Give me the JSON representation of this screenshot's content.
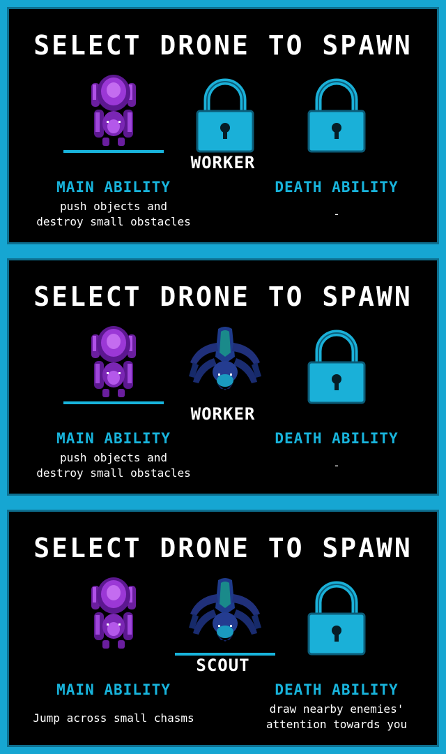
{
  "colors": {
    "background": "#16a6d2",
    "panel": "#000000",
    "accent": "#18b4dc",
    "text": "#ffffff",
    "worker_drone": "#9b38d6",
    "scout_drone": "#1e3a8a",
    "lock": "#1ab0d8"
  },
  "panels": [
    {
      "title": "SELECT DRONE TO SPAWN",
      "slots": [
        {
          "icon": "worker-drone-icon",
          "selected": true
        },
        {
          "icon": "lock-icon",
          "selected": false
        },
        {
          "icon": "lock-icon",
          "selected": false
        }
      ],
      "drone_name": "WORKER",
      "main_ability_label": "MAIN ABILITY",
      "death_ability_label": "DEATH ABILITY",
      "main_ability_text": [
        "push objects and",
        "destroy small obstacles"
      ],
      "death_ability_text": "-"
    },
    {
      "title": "SELECT DRONE TO SPAWN",
      "slots": [
        {
          "icon": "worker-drone-icon",
          "selected": true
        },
        {
          "icon": "scout-drone-icon",
          "selected": false
        },
        {
          "icon": "lock-icon",
          "selected": false
        }
      ],
      "drone_name": "WORKER",
      "main_ability_label": "MAIN ABILITY",
      "death_ability_label": "DEATH ABILITY",
      "main_ability_text": [
        "push objects and",
        "destroy small obstacles"
      ],
      "death_ability_text": "-"
    },
    {
      "title": "SELECT DRONE TO SPAWN",
      "slots": [
        {
          "icon": "worker-drone-icon",
          "selected": false
        },
        {
          "icon": "scout-drone-icon",
          "selected": true
        },
        {
          "icon": "lock-icon",
          "selected": false
        }
      ],
      "drone_name": "SCOUT",
      "main_ability_label": "MAIN ABILITY",
      "death_ability_label": "DEATH ABILITY",
      "main_ability_text": "Jump across small chasms",
      "death_ability_text": [
        "draw nearby enemies'",
        "attention towards you"
      ]
    }
  ]
}
